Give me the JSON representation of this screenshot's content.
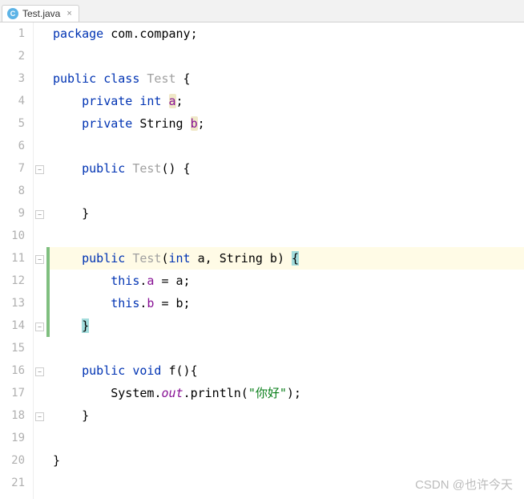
{
  "tab": {
    "filename": "Test.java",
    "icon_label": "C"
  },
  "gutter": {
    "lines": [
      "1",
      "2",
      "3",
      "4",
      "5",
      "6",
      "7",
      "8",
      "9",
      "10",
      "11",
      "12",
      "13",
      "14",
      "15",
      "16",
      "17",
      "18",
      "19",
      "20",
      "21"
    ]
  },
  "code": {
    "l1": {
      "kw_package": "package",
      "pkg": " com.company;"
    },
    "l3": {
      "kw_public": "public",
      "kw_class": "class",
      "cls": "Test",
      "brace": " {"
    },
    "l4": {
      "kw_private": "private",
      "kw_int": "int",
      "field": "a",
      "semi": ";"
    },
    "l5": {
      "kw_private": "private",
      "type": "String",
      "field": "b",
      "semi": ";"
    },
    "l7": {
      "kw_public": "public",
      "ctor": "Test",
      "rest": "() {"
    },
    "l9": {
      "brace": "}"
    },
    "l11": {
      "kw_public": "public",
      "ctor": "Test",
      "paren_open": "(",
      "kw_int": "int",
      "p1": " a, ",
      "type": "String",
      "p2": " b) ",
      "brace": "{"
    },
    "l12": {
      "kw_this": "this",
      "dot": ".",
      "field": "a",
      "rest": " = a;"
    },
    "l13": {
      "kw_this": "this",
      "dot": ".",
      "field": "b",
      "rest": " = b;"
    },
    "l14": {
      "brace": "}"
    },
    "l16": {
      "kw_public": "public",
      "kw_void": "void",
      "name": " f(){"
    },
    "l17": {
      "cls": "System",
      "dot1": ".",
      "out": "out",
      "dot2": ".",
      "method": "println(",
      "str": "\"你好\"",
      "close": ");"
    },
    "l18": {
      "brace": "}"
    },
    "l20": {
      "brace": "}"
    }
  },
  "watermark": "CSDN @也许今天"
}
